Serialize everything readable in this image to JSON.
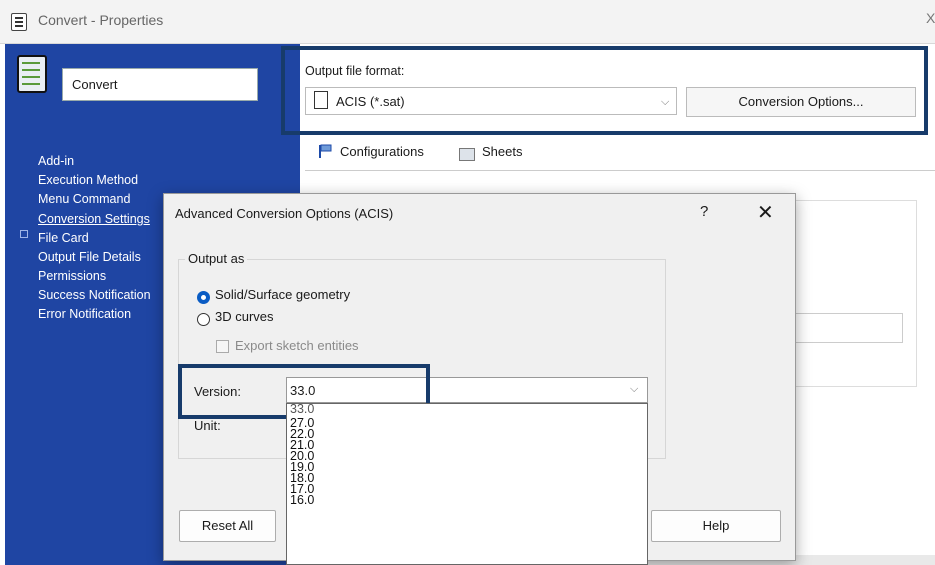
{
  "window": {
    "title": "Convert - Properties",
    "close_glyph": "X"
  },
  "config": {
    "name": "Convert",
    "icon": "task-config-icon"
  },
  "sidebar": {
    "items": [
      {
        "label": "Add-in",
        "active": false
      },
      {
        "label": "Execution Method",
        "active": false
      },
      {
        "label": "Menu Command",
        "active": false
      },
      {
        "label": "Conversion Settings",
        "active": true
      },
      {
        "label": "File Card",
        "active": false
      },
      {
        "label": "Output File Details",
        "active": false
      },
      {
        "label": "Permissions",
        "active": false
      },
      {
        "label": "Success Notification",
        "active": false
      },
      {
        "label": "Error Notification",
        "active": false
      }
    ]
  },
  "output": {
    "label": "Output file format:",
    "format_value": "ACIS (*.sat)",
    "conversion_options_button": "Conversion Options..."
  },
  "tabs": [
    {
      "label": "Configurations",
      "icon": "flag-icon"
    },
    {
      "label": "Sheets",
      "icon": "sheet-icon"
    }
  ],
  "dialog": {
    "title": "Advanced Conversion Options (ACIS)",
    "help_glyph": "?",
    "close_glyph": "✕",
    "output_as": {
      "label": "Output as",
      "options": [
        {
          "label": "Solid/Surface geometry",
          "selected": true
        },
        {
          "label": "3D curves",
          "selected": false
        }
      ],
      "export_sketch": {
        "label": "Export sketch entities",
        "checked": false,
        "enabled": false
      }
    },
    "version": {
      "label": "Version:",
      "value": "33.0"
    },
    "unit": {
      "label": "Unit:"
    },
    "version_options": [
      "33.0",
      "27.0",
      "22.0",
      "21.0",
      "20.0",
      "19.0",
      "18.0",
      "17.0",
      "16.0"
    ],
    "reset_button": "Reset All",
    "help_button": "Help"
  },
  "colors": {
    "sidebar": "#1f45a3",
    "highlight": "#173b6b",
    "radio_on": "#0a5cc4"
  }
}
